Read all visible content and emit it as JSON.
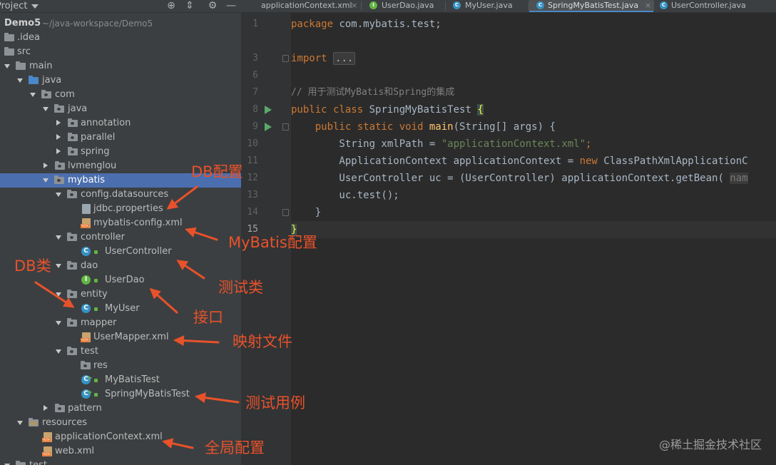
{
  "project_panel": {
    "title": "Project",
    "header_icons": [
      "target-icon",
      "collapse-icon",
      "gear-icon",
      "minimize-icon"
    ],
    "tree": [
      {
        "label": "Demo5",
        "path": "~/java-workspace/Demo5",
        "type": "module"
      },
      {
        "label": ".idea",
        "type": "folder"
      },
      {
        "label": "src",
        "type": "folder"
      },
      {
        "label": "main",
        "type": "folder"
      },
      {
        "label": "java",
        "type": "source-folder"
      },
      {
        "label": "com",
        "type": "package"
      },
      {
        "label": "java",
        "type": "package"
      },
      {
        "label": "annotation",
        "type": "package"
      },
      {
        "label": "parallel",
        "type": "package"
      },
      {
        "label": "spring",
        "type": "package"
      },
      {
        "label": "lvmenglou",
        "type": "package"
      },
      {
        "label": "mybatis",
        "type": "package",
        "selected": true
      },
      {
        "label": "config.datasources",
        "type": "package"
      },
      {
        "label": "jdbc.properties",
        "type": "properties-file"
      },
      {
        "label": "mybatis-config.xml",
        "type": "xml-file"
      },
      {
        "label": "controller",
        "type": "package"
      },
      {
        "label": "UserController",
        "type": "class"
      },
      {
        "label": "dao",
        "type": "package"
      },
      {
        "label": "UserDao",
        "type": "interface"
      },
      {
        "label": "entity",
        "type": "package"
      },
      {
        "label": "MyUser",
        "type": "class"
      },
      {
        "label": "mapper",
        "type": "package"
      },
      {
        "label": "UserMapper.xml",
        "type": "xml-file"
      },
      {
        "label": "test",
        "type": "package"
      },
      {
        "label": "res",
        "type": "package"
      },
      {
        "label": "MyBatisTest",
        "type": "test-class"
      },
      {
        "label": "SpringMyBatisTest",
        "type": "test-class"
      },
      {
        "label": "pattern",
        "type": "package"
      },
      {
        "label": "resources",
        "type": "resource-folder"
      },
      {
        "label": "applicationContext.xml",
        "type": "xml-file"
      },
      {
        "label": "web.xml",
        "type": "xml-file"
      },
      {
        "label": "test",
        "type": "folder"
      }
    ]
  },
  "tabs": [
    {
      "label": "applicationContext.xml",
      "icon": "xml-file-icon"
    },
    {
      "label": "UserDao.java",
      "icon": "interface-icon"
    },
    {
      "label": "MyUser.java",
      "icon": "class-icon"
    },
    {
      "label": "SpringMyBatisTest.java",
      "icon": "test-class-icon",
      "active": true
    },
    {
      "label": "UserController.java",
      "icon": "class-icon"
    }
  ],
  "editor": {
    "line_numbers": [
      "1",
      "3",
      "6",
      "7",
      "8",
      "9",
      "10",
      "11",
      "12",
      "13",
      "14",
      "15"
    ],
    "current_line": "15",
    "code": {
      "l1_kw": "package",
      "l1_rest": " com.mybatis.test;",
      "l3_kw": "import",
      "l3_dots": "...",
      "l7_comment": "// 用于测试MyBatis和Spring的集成",
      "l8_kw": "public class",
      "l8_rest": " SpringMyBatisTest ",
      "l8_brace": "{",
      "l9_kw": "    public static void",
      "l9_fn": " main",
      "l9_rest": "(String[] args) {",
      "l10_a": "        String xmlPath = ",
      "l10_str": "\"applicationContext.xml\"",
      "l10_end": ";",
      "l11_a": "        ApplicationContext applicationContext = ",
      "l11_kw": "new",
      "l11_rest": " ClassPathXmlApplicationC",
      "l12_a": "        UserController uc = (UserController) applicationContext.getBean( ",
      "l12_hint": "nam",
      "l13": "        uc.test();",
      "l14": "    }",
      "l15_brace": "}"
    }
  },
  "annotations": {
    "db_config": "DB配置",
    "mybatis_config": "MyBatis配置",
    "db_class": "DB类",
    "test_class": "测试类",
    "interface": "接口",
    "mapping_file": "映射文件",
    "test_case": "测试用例",
    "global_config": "全局配置",
    "color": "#e8522b"
  },
  "watermark": "@稀土掘金技术社区"
}
